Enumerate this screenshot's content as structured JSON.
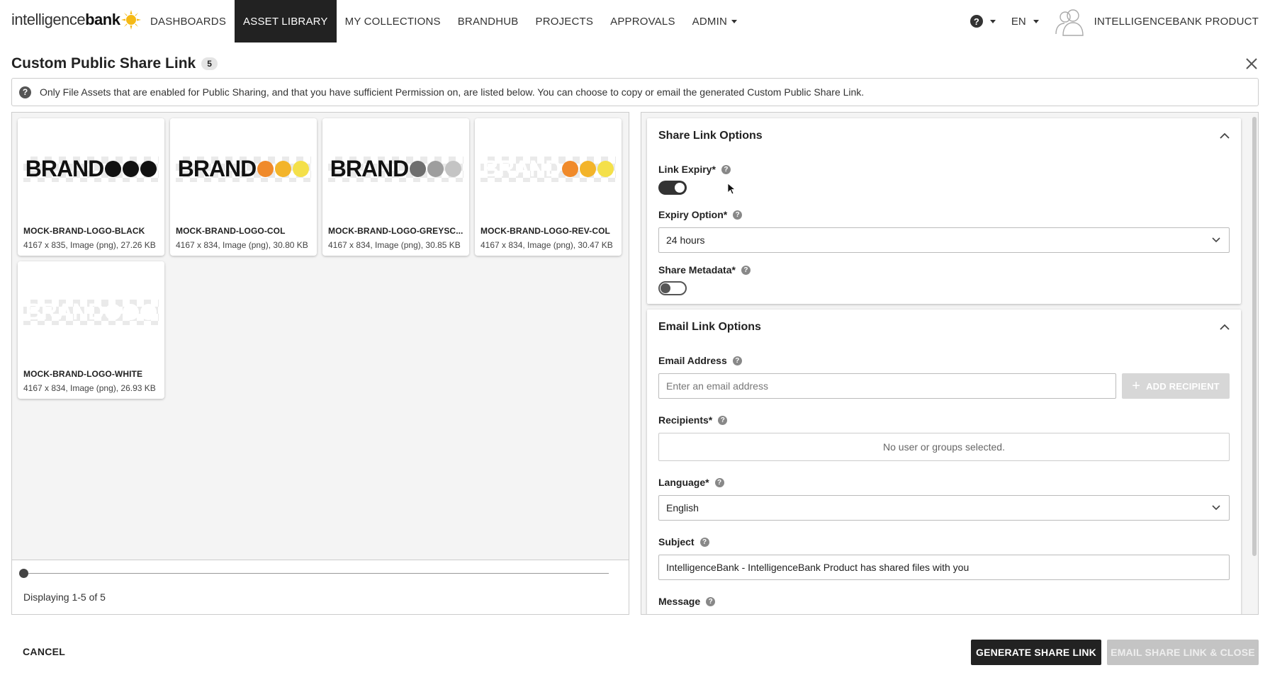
{
  "nav": {
    "logo_prefix": "intelligence",
    "logo_suffix": "bank",
    "items": [
      {
        "label": "DASHBOARDS",
        "active": false
      },
      {
        "label": "ASSET LIBRARY",
        "active": true
      },
      {
        "label": "MY COLLECTIONS",
        "active": false
      },
      {
        "label": "BRANDHUB",
        "active": false
      },
      {
        "label": "PROJECTS",
        "active": false
      },
      {
        "label": "APPROVALS",
        "active": false
      },
      {
        "label": "ADMIN",
        "active": false
      }
    ],
    "help_glyph": "?",
    "language": "EN",
    "user_name": "INTELLIGENCEBANK PRODUCT"
  },
  "page": {
    "title": "Custom Public Share Link",
    "count": "5",
    "info": "Only File Assets that are enabled for Public Sharing, and that you have sufficient Permission on, are listed below. You can choose to copy or email the generated Custom Public Share Link."
  },
  "assets": [
    {
      "title": "MOCK-BRAND-LOGO-BLACK",
      "meta": "4167 x 835, Image (png), 27.26 KB",
      "brand_text": "BRAND",
      "dots": [
        "#111111",
        "#111111",
        "#111111"
      ],
      "brand_color": "#111111"
    },
    {
      "title": "MOCK-BRAND-LOGO-COL",
      "meta": "4167 x 834, Image (png), 30.80 KB",
      "brand_text": "BRAND",
      "dots": [
        "#f08a2a",
        "#f3b42a",
        "#f4e04a"
      ],
      "brand_color": "#111111"
    },
    {
      "title": "MOCK-BRAND-LOGO-GREYSC...",
      "meta": "4167 x 834, Image (png), 30.85 KB",
      "brand_text": "BRAND",
      "dots": [
        "#6e6e6e",
        "#9e9e9e",
        "#c4c4c4"
      ],
      "brand_color": "#111111"
    },
    {
      "title": "MOCK-BRAND-LOGO-REV-COL",
      "meta": "4167 x 834, Image (png), 30.47 KB",
      "brand_text": "BRAND",
      "dots": [
        "#f08a2a",
        "#f3b42a",
        "#f4e04a"
      ],
      "brand_color": "#ffffff"
    },
    {
      "title": "MOCK-BRAND-LOGO-WHITE",
      "meta": "4167 x 834, Image (png), 26.93 KB",
      "brand_text": "BRAND",
      "dots": [
        "#ffffff",
        "#ffffff",
        "#ffffff"
      ],
      "brand_color": "#ffffff"
    }
  ],
  "pagination": {
    "display": "Displaying 1-5 of 5"
  },
  "share_options": {
    "title": "Share Link Options",
    "link_expiry_label": "Link Expiry*",
    "link_expiry_on": true,
    "expiry_option_label": "Expiry Option*",
    "expiry_option_value": "24 hours",
    "share_metadata_label": "Share Metadata*",
    "share_metadata_on": false
  },
  "email_options": {
    "title": "Email Link Options",
    "email_label": "Email Address",
    "email_placeholder": "Enter an email address",
    "add_recipient": "ADD RECIPIENT",
    "recipients_label": "Recipients*",
    "recipients_empty": "No user or groups selected.",
    "language_label": "Language*",
    "language_value": "English",
    "subject_label": "Subject",
    "subject_value": "IntelligenceBank - IntelligenceBank Product has shared files with you",
    "message_label": "Message"
  },
  "footer": {
    "cancel": "CANCEL",
    "generate": "GENERATE SHARE LINK",
    "email_close": "EMAIL SHARE LINK & CLOSE"
  },
  "colors": {
    "accent_dark": "#222222",
    "logo_sun": "#f5b915"
  }
}
